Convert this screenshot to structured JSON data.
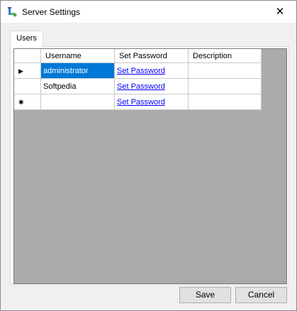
{
  "window": {
    "title": "Server Settings",
    "close_glyph": "✕"
  },
  "tabs": [
    {
      "label": "Users"
    }
  ],
  "grid": {
    "columns": [
      "Username",
      "Set Password",
      "Description"
    ],
    "rows": [
      {
        "indicator": "▶",
        "username": "administrator",
        "password_link": "Set Password",
        "description": ""
      },
      {
        "indicator": "",
        "username": "Softpedia",
        "password_link": "Set Password",
        "description": ""
      },
      {
        "indicator": "✱",
        "username": "",
        "password_link": "Set Password",
        "description": ""
      }
    ]
  },
  "buttons": {
    "save": "Save",
    "cancel": "Cancel"
  },
  "colors": {
    "selection": "#0078d7",
    "link": "#0000ff",
    "grid_background": "#ababab"
  },
  "icons": {
    "app": "app-settings-icon",
    "close": "close-icon",
    "current_row": "current-row-arrow-icon",
    "new_row": "new-row-asterisk-icon"
  }
}
